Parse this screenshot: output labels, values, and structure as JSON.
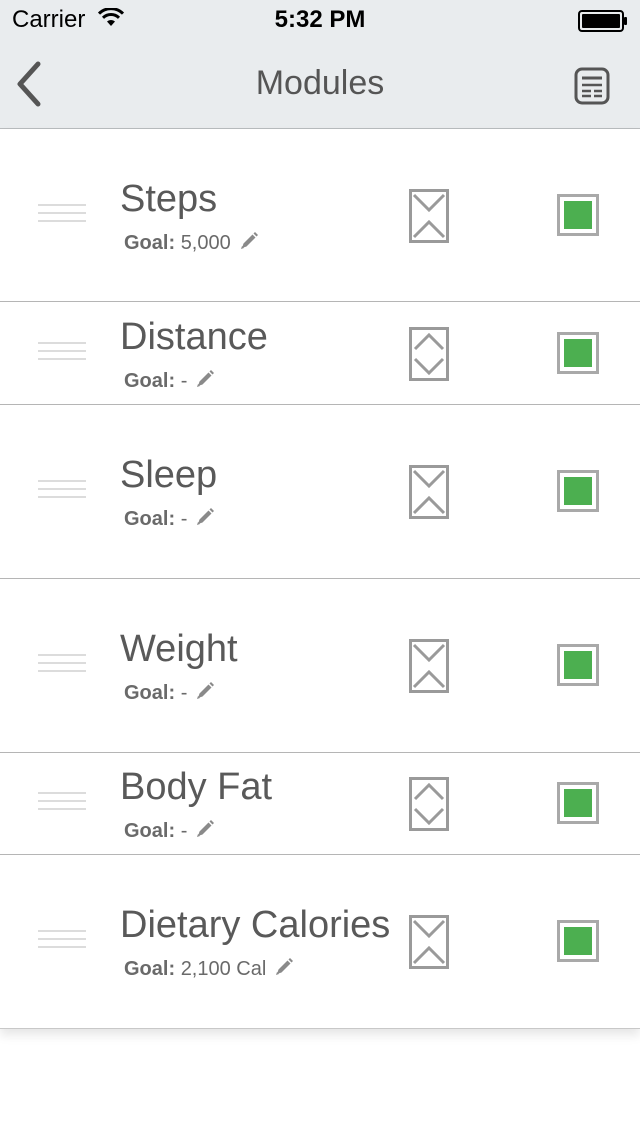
{
  "status_bar": {
    "carrier": "Carrier",
    "time": "5:32 PM"
  },
  "nav": {
    "title": "Modules",
    "back_icon": "chevron-left-icon",
    "action_icon": "report-icon"
  },
  "colors": {
    "accent_green": "#4caf50",
    "bar_bg": "#e9ecee"
  },
  "modules": [
    {
      "name": "Steps",
      "goal_label": "Goal:",
      "goal_value": "5,000",
      "enabled": true,
      "toggle_icon": "collapse-icon"
    },
    {
      "name": "Distance",
      "goal_label": "Goal:",
      "goal_value": "-",
      "enabled": true,
      "toggle_icon": "expand-icon"
    },
    {
      "name": "Sleep",
      "goal_label": "Goal:",
      "goal_value": "-",
      "enabled": true,
      "toggle_icon": "collapse-icon"
    },
    {
      "name": "Weight",
      "goal_label": "Goal:",
      "goal_value": "-",
      "enabled": true,
      "toggle_icon": "collapse-icon"
    },
    {
      "name": "Body Fat",
      "goal_label": "Goal:",
      "goal_value": "-",
      "enabled": true,
      "toggle_icon": "expand-icon"
    },
    {
      "name": "Dietary Calories",
      "goal_label": "Goal:",
      "goal_value": "2,100 Cal",
      "enabled": true,
      "toggle_icon": "collapse-icon"
    }
  ]
}
